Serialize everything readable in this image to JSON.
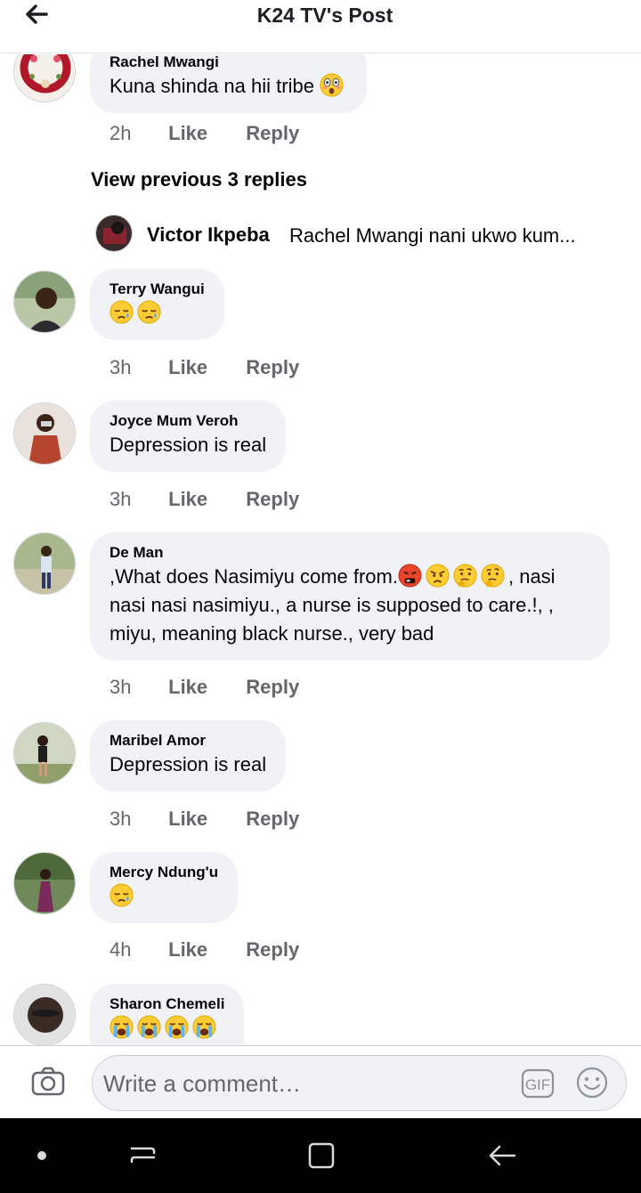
{
  "header": {
    "title": "K24 TV's Post",
    "back_icon": "arrow-left-icon"
  },
  "top_comment": {
    "author": "Rachel Mwangi",
    "text": "Kuna shinda na hii tribe",
    "emoji": [
      "astonished-face-emoji"
    ],
    "time": "2h",
    "like": "Like",
    "reply": "Reply"
  },
  "view_previous": "View previous 3 replies",
  "reply_preview": {
    "author": "Victor Ikpeba",
    "text": "Rachel Mwangi nani ukwo kum..."
  },
  "comments": [
    {
      "author": "Terry Wangui",
      "text": "",
      "emoji": [
        "sleepy-face-emoji",
        "sleepy-face-emoji"
      ],
      "time": "3h",
      "like": "Like",
      "reply": "Reply"
    },
    {
      "author": "Joyce Mum Veroh",
      "text": "Depression is real",
      "emoji": [],
      "time": "3h",
      "like": "Like",
      "reply": "Reply"
    },
    {
      "author": "De Man",
      "lines": [
        ",What does Nasimiyu come from.",
        ", nasi",
        "nasi nasi nasimiyu., a nurse is supposed to care.!, ,",
        "miyu, meaning black nurse., very bad"
      ],
      "emoji": [
        "face-with-symbols-emoji",
        "angry-face-emoji",
        "thinking-face-emoji",
        "thinking-face-emoji"
      ],
      "time": "3h",
      "like": "Like",
      "reply": "Reply"
    },
    {
      "author": "Maribel Amor",
      "text": "Depression is real",
      "emoji": [],
      "time": "3h",
      "like": "Like",
      "reply": "Reply"
    },
    {
      "author": "Mercy Ndung'u",
      "text": "",
      "emoji": [
        "sleepy-face-emoji"
      ],
      "time": "4h",
      "like": "Like",
      "reply": "Reply"
    },
    {
      "author": "Sharon Chemeli",
      "text": "",
      "emoji": [
        "loudly-crying-face-emoji",
        "loudly-crying-face-emoji",
        "loudly-crying-face-emoji",
        "loudly-crying-face-emoji"
      ]
    }
  ],
  "composer": {
    "placeholder": "Write a comment…",
    "gif_label": "GIF",
    "camera_icon": "camera-icon",
    "emoji_icon": "smiley-icon"
  },
  "navbar": {
    "icons": [
      "dot-icon",
      "recent-apps-icon",
      "home-square-icon",
      "back-arrow-icon"
    ]
  },
  "colors": {
    "bubble": "#f0f2f5",
    "meta_text": "#65676b",
    "text": "#050505",
    "navbar": "#000000"
  }
}
